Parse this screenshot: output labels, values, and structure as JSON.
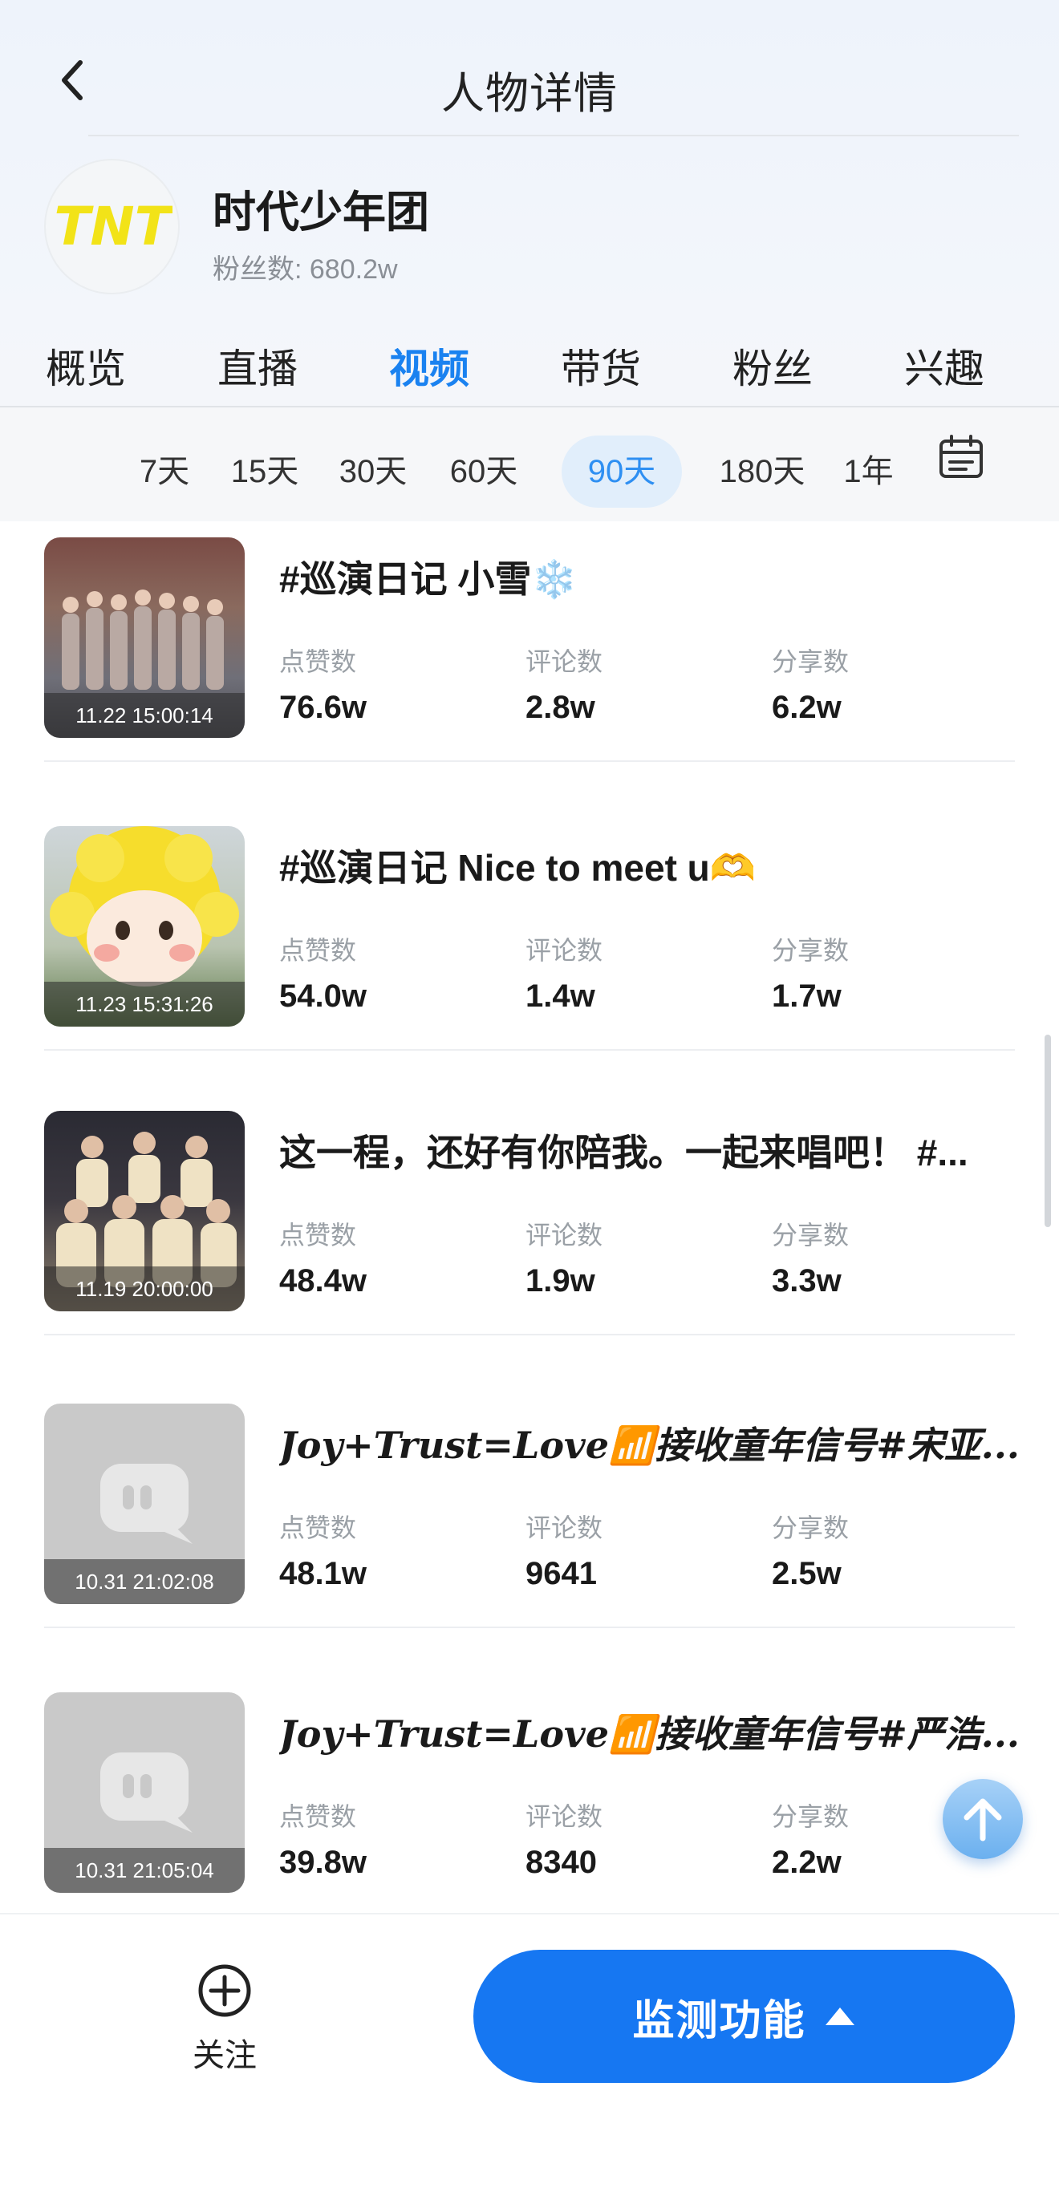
{
  "nav": {
    "title": "人物详情"
  },
  "profile": {
    "name": "时代少年团",
    "fans": "粉丝数: 680.2w",
    "logo_text": "TNT"
  },
  "tabs": [
    {
      "label": "概览"
    },
    {
      "label": "直播"
    },
    {
      "label": "视频",
      "active": true
    },
    {
      "label": "带货"
    },
    {
      "label": "粉丝"
    },
    {
      "label": "兴趣"
    }
  ],
  "periods": [
    {
      "label": "7天"
    },
    {
      "label": "15天"
    },
    {
      "label": "30天"
    },
    {
      "label": "60天"
    },
    {
      "label": "90天",
      "active": true
    },
    {
      "label": "180天"
    },
    {
      "label": "1年"
    }
  ],
  "stat_labels": {
    "likes": "点赞数",
    "comments": "评论数",
    "shares": "分享数"
  },
  "videos": [
    {
      "time": "11.22 15:00:14",
      "title": "#巡演日记 小雪❄️",
      "likes": "76.6w",
      "comments": "2.8w",
      "shares": "6.2w",
      "thumb": "group-photo"
    },
    {
      "time": "11.23 15:31:26",
      "title": "#巡演日记 Nice to meet u🫶",
      "likes": "54.0w",
      "comments": "1.4w",
      "shares": "1.7w",
      "thumb": "mascot"
    },
    {
      "time": "11.19 20:00:00",
      "title": "这一程，还好有你陪我。一起来唱吧！ #...",
      "likes": "48.4w",
      "comments": "1.9w",
      "shares": "3.3w",
      "thumb": "group-photo"
    },
    {
      "time": "10.31 21:02:08",
      "title": "Joy+Trust=Love📶接收童年信号#宋亚...",
      "likes": "48.1w",
      "comments": "9641",
      "shares": "2.5w",
      "thumb": "placeholder"
    },
    {
      "time": "10.31 21:05:04",
      "title": "Joy+Trust=Love📶接收童年信号#严浩...",
      "likes": "39.8w",
      "comments": "8340",
      "shares": "2.2w",
      "thumb": "placeholder"
    }
  ],
  "bottom": {
    "follow_label": "关注",
    "monitor_label": "监测功能"
  },
  "colors": {
    "accent": "#1a82f0",
    "button": "#1677f2",
    "period_active_bg": "#e1eefb"
  }
}
